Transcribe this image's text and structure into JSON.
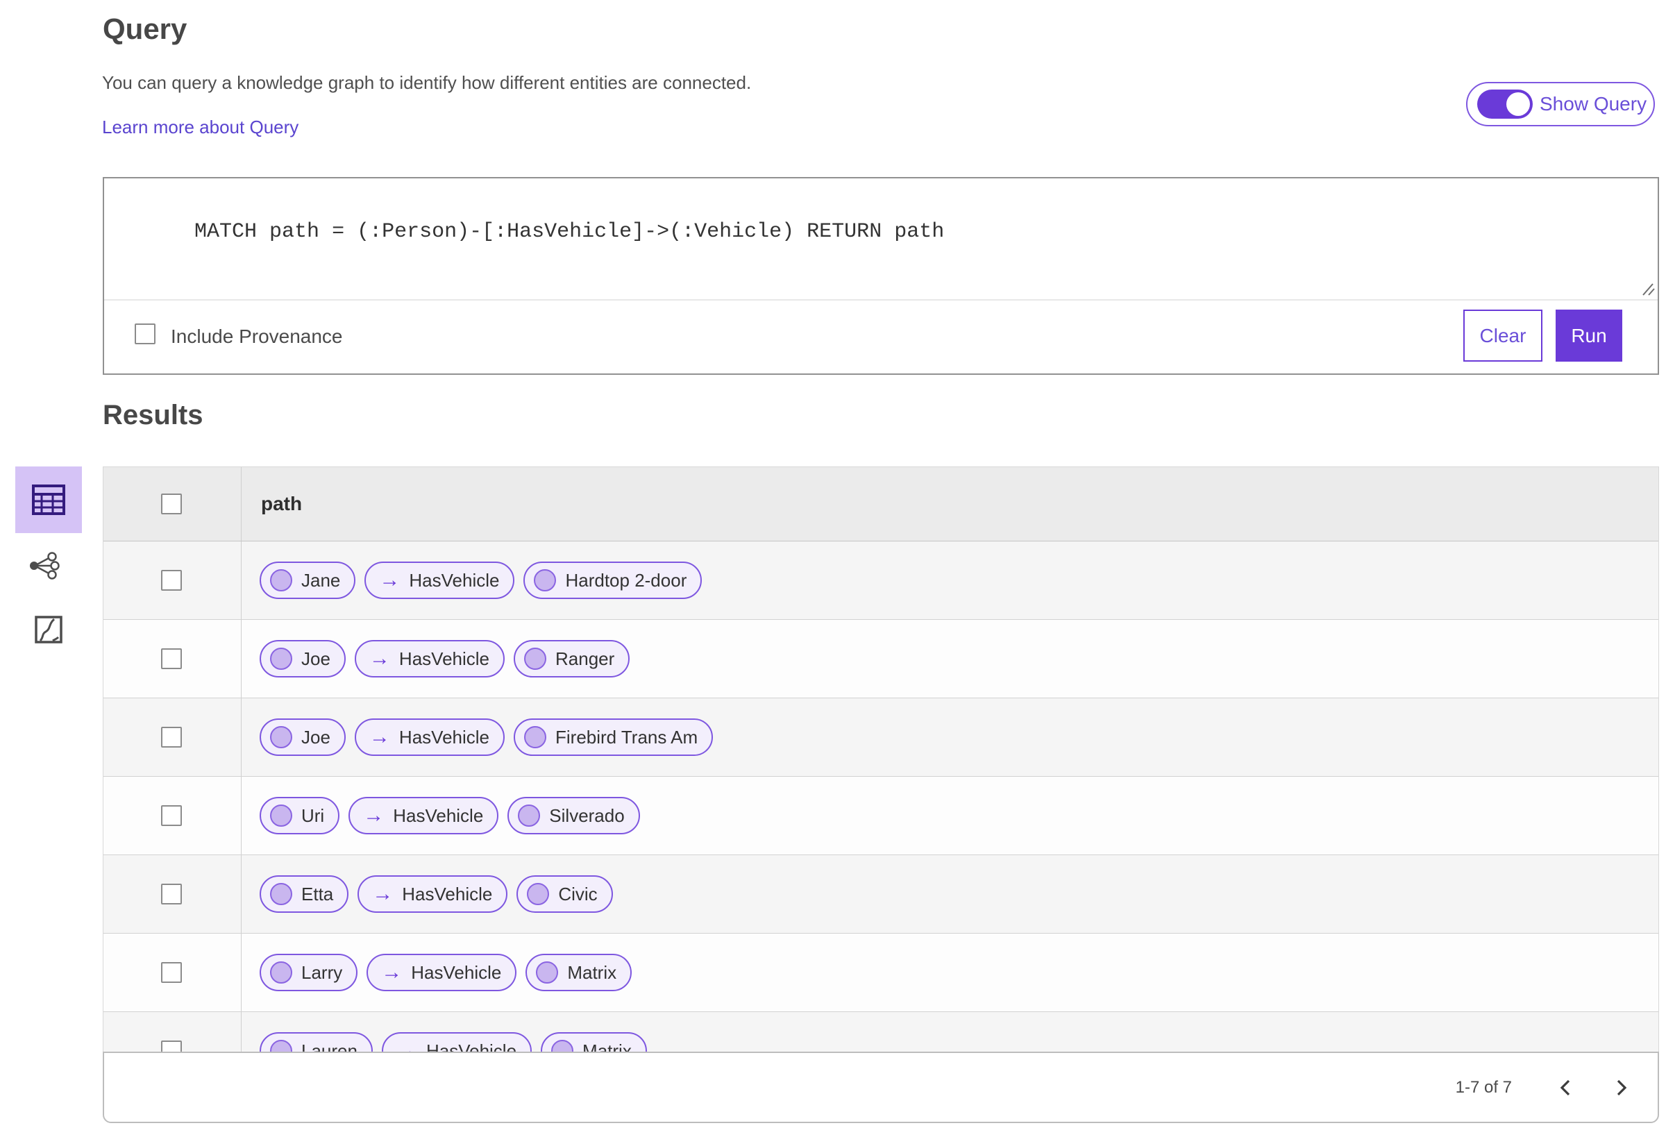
{
  "query_section": {
    "title": "Query",
    "description": "You can query a knowledge graph to identify how different entities are connected.",
    "learn_more_label": "Learn more about Query",
    "show_query": {
      "label": "Show Query",
      "state": "on"
    },
    "query_text": "MATCH path = (:Person)-[:HasVehicle]->(:Vehicle) RETURN path",
    "include_provenance": {
      "label": "Include Provenance",
      "checked": false
    },
    "clear_label": "Clear",
    "run_label": "Run"
  },
  "results_section": {
    "title": "Results",
    "view_switcher": [
      {
        "name": "table-view",
        "selected": true
      },
      {
        "name": "link-chart-view",
        "selected": false
      },
      {
        "name": "map-view",
        "selected": false
      }
    ],
    "table": {
      "columns": [
        "path"
      ],
      "arrow_glyph": "→",
      "rows": [
        {
          "cells": [
            {
              "kind": "entity",
              "label": "Jane"
            },
            {
              "kind": "relationship",
              "label": "HasVehicle"
            },
            {
              "kind": "entity",
              "label": "Hardtop 2-door"
            }
          ]
        },
        {
          "cells": [
            {
              "kind": "entity",
              "label": "Joe"
            },
            {
              "kind": "relationship",
              "label": "HasVehicle"
            },
            {
              "kind": "entity",
              "label": "Ranger"
            }
          ]
        },
        {
          "cells": [
            {
              "kind": "entity",
              "label": "Joe"
            },
            {
              "kind": "relationship",
              "label": "HasVehicle"
            },
            {
              "kind": "entity",
              "label": "Firebird Trans Am"
            }
          ]
        },
        {
          "cells": [
            {
              "kind": "entity",
              "label": "Uri"
            },
            {
              "kind": "relationship",
              "label": "HasVehicle"
            },
            {
              "kind": "entity",
              "label": "Silverado"
            }
          ]
        },
        {
          "cells": [
            {
              "kind": "entity",
              "label": "Etta"
            },
            {
              "kind": "relationship",
              "label": "HasVehicle"
            },
            {
              "kind": "entity",
              "label": "Civic"
            }
          ]
        },
        {
          "cells": [
            {
              "kind": "entity",
              "label": "Larry"
            },
            {
              "kind": "relationship",
              "label": "HasVehicle"
            },
            {
              "kind": "entity",
              "label": "Matrix"
            }
          ]
        },
        {
          "cells": [
            {
              "kind": "entity",
              "label": "Lauren"
            },
            {
              "kind": "relationship",
              "label": "HasVehicle"
            },
            {
              "kind": "entity",
              "label": "Matrix"
            }
          ]
        }
      ]
    },
    "pagination": {
      "range_label": "1-7 of 7"
    }
  },
  "colors": {
    "accent_purple": "#6a3ad8",
    "pill_border": "#7e57e0",
    "pill_background": "#f3effc",
    "pill_circle_fill": "#c9b6ef",
    "selected_view_background": "#d5c3f6",
    "link_color": "#5a44cf",
    "table_header_background": "#ebebeb",
    "row_alternate_background": "#f5f5f5"
  }
}
